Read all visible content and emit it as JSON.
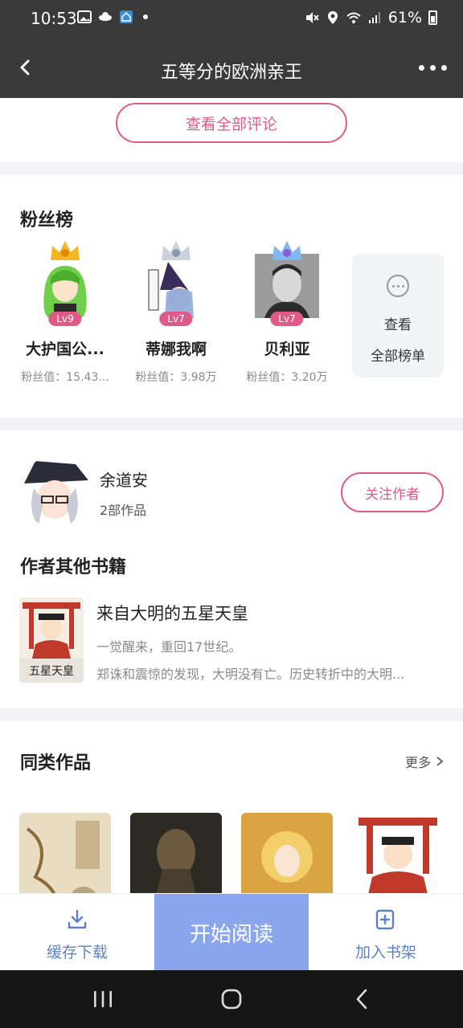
{
  "status_bar": {
    "time": "10:53",
    "battery": "61%"
  },
  "header": {
    "title": "五等分的欧洲亲王"
  },
  "comments": {
    "all_label": "查看全部评论"
  },
  "fans": {
    "title": "粉丝榜",
    "items": [
      {
        "rank": "1",
        "level": "Lv9",
        "name": "大护国公...",
        "score": "粉丝值：15.43..."
      },
      {
        "rank": "2",
        "level": "Lv7",
        "name": "蒂娜我啊",
        "score": "粉丝值：3.98万"
      },
      {
        "rank": "3",
        "level": "Lv7",
        "name": "贝利亚",
        "score": "粉丝值：3.20万"
      }
    ],
    "all_rank": {
      "line1": "查看",
      "line2": "全部榜单"
    }
  },
  "author": {
    "name": "余道安",
    "works": "2部作品",
    "follow_label": "关注作者",
    "other_books_title": "作者其他书籍",
    "book": {
      "title": "来自大明的五星天皇",
      "line1": "一觉醒来，重回17世纪。",
      "line2": "郑诛和震惊的发现，大明没有亡。历史转折中的大明..."
    }
  },
  "similar": {
    "title": "同类作品",
    "more_label": "更多"
  },
  "actions": {
    "download": "缓存下载",
    "start_read": "开始阅读",
    "add_shelf": "加入书架"
  },
  "colors": {
    "accent": "#e05a87",
    "action_blue": "#5b82c6",
    "start_bg": "#8aa6ee",
    "topbar": "#3a3a3a"
  }
}
